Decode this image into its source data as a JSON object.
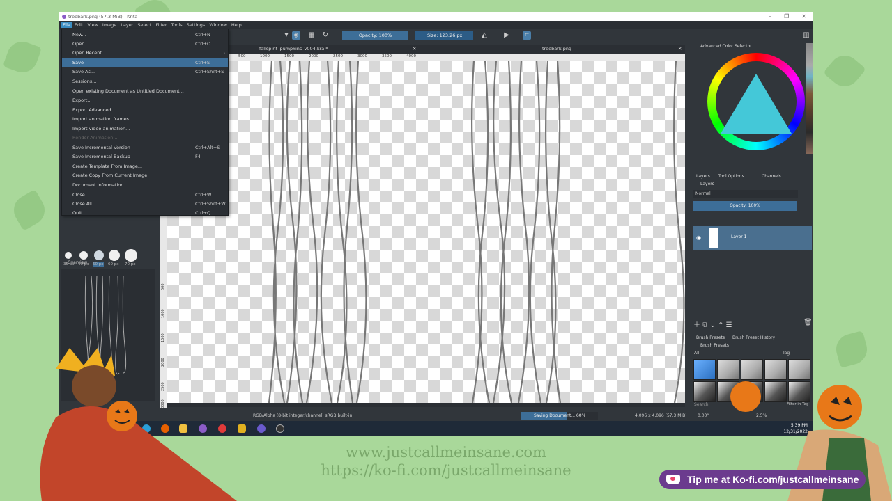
{
  "window": {
    "title": "treebark.png (57.3 MiB) - Krita",
    "controls": [
      "–",
      "❐",
      "✕"
    ]
  },
  "menubar": [
    "File",
    "Edit",
    "View",
    "Image",
    "Layer",
    "Select",
    "Filter",
    "Tools",
    "Settings",
    "Window",
    "Help"
  ],
  "toolbar": {
    "opacity": "Opacity: 100%",
    "size": "Size: 123.26 px"
  },
  "file_menu": [
    {
      "label": "New...",
      "shortcut": "Ctrl+N"
    },
    {
      "label": "Open...",
      "shortcut": "Ctrl+O"
    },
    {
      "label": "Open Recent",
      "shortcut": ""
    },
    {
      "label": "Save",
      "shortcut": "Ctrl+S",
      "highlighted": true
    },
    {
      "label": "Save As...",
      "shortcut": "Ctrl+Shift+S"
    },
    {
      "label": "Sessions...",
      "shortcut": ""
    },
    {
      "label": "Open existing Document as Untitled Document...",
      "shortcut": ""
    },
    {
      "label": "Export...",
      "shortcut": ""
    },
    {
      "label": "Export Advanced...",
      "shortcut": ""
    },
    {
      "label": "Import animation frames...",
      "shortcut": ""
    },
    {
      "label": "Import video animation...",
      "shortcut": ""
    },
    {
      "label": "Render Animation...",
      "shortcut": "",
      "disabled": true
    },
    {
      "label": "Save Incremental Version",
      "shortcut": "Ctrl+Alt+S"
    },
    {
      "label": "Save Incremental Backup",
      "shortcut": "F4"
    },
    {
      "label": "Create Template From Image...",
      "shortcut": ""
    },
    {
      "label": "Create Copy From Current Image",
      "shortcut": ""
    },
    {
      "label": "Document Information",
      "shortcut": ""
    },
    {
      "label": "Close",
      "shortcut": "Ctrl+W"
    },
    {
      "label": "Close All",
      "shortcut": "Ctrl+Shift+W"
    },
    {
      "label": "Quit",
      "shortcut": "Ctrl+Q"
    }
  ],
  "tabs": {
    "tab1": "fallspirit_pumpkins_v004.kra *",
    "tab2": "treebark.png"
  },
  "ruler": {
    "top": [
      "500",
      "1000",
      "1500",
      "2000",
      "2500",
      "3000",
      "3500",
      "4000"
    ],
    "left": [
      "500",
      "1000",
      "1500",
      "2000",
      "2500",
      "3000"
    ]
  },
  "brush_sizes": [
    "35 px",
    "40 px",
    "50 px",
    "60 px",
    "70 px"
  ],
  "overview": {
    "title": "Overview"
  },
  "statusbar": {
    "color": "RGB/Alpha (8-bit integer/channel)  sRGB built-in",
    "saving": "Saving Document... 60%",
    "saving_progress": 0.6,
    "dims": "4,096 x 4,096 (57.3 MiB)",
    "rotation": "0.00°",
    "zoom": "2.5%"
  },
  "right": {
    "color_selector": "Advanced Color Selector",
    "panel_tabs": [
      "Layers",
      "Tool Options",
      "Channels"
    ],
    "layers_title": "Layers",
    "blend_mode": "Normal",
    "layer_opacity": "Opacity:  100%",
    "layer_name": "Layer 1",
    "preset_tabs": [
      "Brush Presets",
      "Brush Preset History"
    ],
    "presets_title": "Brush Presets",
    "preset_filter": "All",
    "tag_label": "Tag",
    "search": "Search",
    "filter_tag": "Filter in Tag"
  },
  "clock": {
    "time": "5:39 PM",
    "date": "12/31/2022"
  },
  "overlay": {
    "url1": "www.justcallmeinsane.com",
    "url2": "https://ko-fi.com/justcallmeinsane",
    "kofi": "Tip me at Ko-fi.com/justcallmeinsane"
  },
  "colors": {
    "background": "#a9d89a",
    "krita_panel": "#31363b",
    "highlight": "#3d6e98",
    "kofi": "#6b3b8e"
  }
}
